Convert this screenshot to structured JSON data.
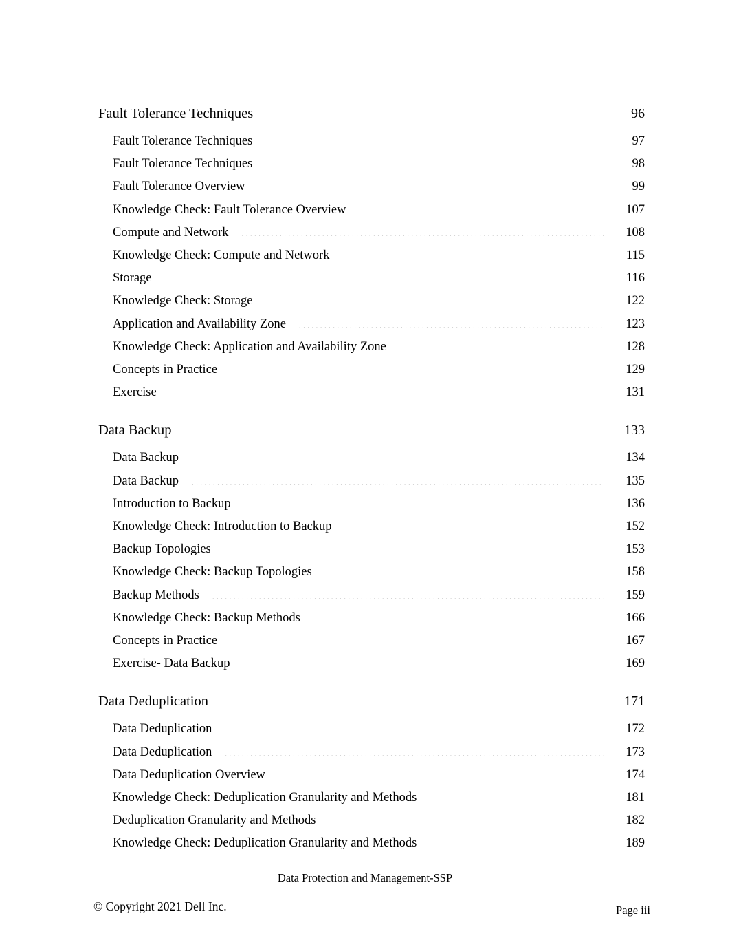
{
  "document": {
    "type": "table-of-contents",
    "sections": [
      {
        "heading": {
          "title": "Fault Tolerance Techniques",
          "page": "96"
        },
        "entries": [
          {
            "title": "Fault Tolerance Techniques",
            "page": "97"
          },
          {
            "title": "Fault Tolerance Techniques",
            "page": "98"
          },
          {
            "title": "Fault Tolerance Overview",
            "page": "99"
          },
          {
            "title": "Knowledge Check: Fault Tolerance Overview",
            "page": "107"
          },
          {
            "title": "Compute and Network",
            "page": "108"
          },
          {
            "title": "Knowledge Check: Compute and Network",
            "page": "115"
          },
          {
            "title": "Storage",
            "page": "116"
          },
          {
            "title": "Knowledge Check: Storage",
            "page": "122"
          },
          {
            "title": "Application and Availability Zone",
            "page": "123"
          },
          {
            "title": "Knowledge Check: Application and Availability Zone",
            "page": "128"
          },
          {
            "title": "Concepts in Practice",
            "page": "129"
          },
          {
            "title": "Exercise",
            "page": "131"
          }
        ]
      },
      {
        "heading": {
          "title": "Data Backup",
          "page": "133"
        },
        "entries": [
          {
            "title": "Data Backup",
            "page": "134"
          },
          {
            "title": "Data Backup",
            "page": "135"
          },
          {
            "title": "Introduction to Backup",
            "page": "136"
          },
          {
            "title": "Knowledge Check: Introduction to Backup",
            "page": "152"
          },
          {
            "title": "Backup Topologies",
            "page": "153"
          },
          {
            "title": "Knowledge Check: Backup Topologies",
            "page": "158"
          },
          {
            "title": "Backup Methods",
            "page": "159"
          },
          {
            "title": "Knowledge Check: Backup Methods",
            "page": "166"
          },
          {
            "title": "Concepts in Practice",
            "page": "167"
          },
          {
            "title": "Exercise- Data Backup",
            "page": "169"
          }
        ]
      },
      {
        "heading": {
          "title": "Data Deduplication",
          "page": "171"
        },
        "entries": [
          {
            "title": "Data Deduplication",
            "page": "172"
          },
          {
            "title": "Data Deduplication",
            "page": "173"
          },
          {
            "title": "Data Deduplication Overview",
            "page": "174"
          },
          {
            "title": "Knowledge Check: Deduplication Granularity and Methods",
            "page": "181"
          },
          {
            "title": "Deduplication Granularity and Methods",
            "page": "182"
          },
          {
            "title": "Knowledge Check: Deduplication Granularity and Methods",
            "page": "189"
          }
        ]
      }
    ]
  },
  "footer": {
    "subject": "Data Protection and Management-SSP",
    "copyright": "© Copyright 2021 Dell Inc.",
    "page_label": "Page iii"
  }
}
